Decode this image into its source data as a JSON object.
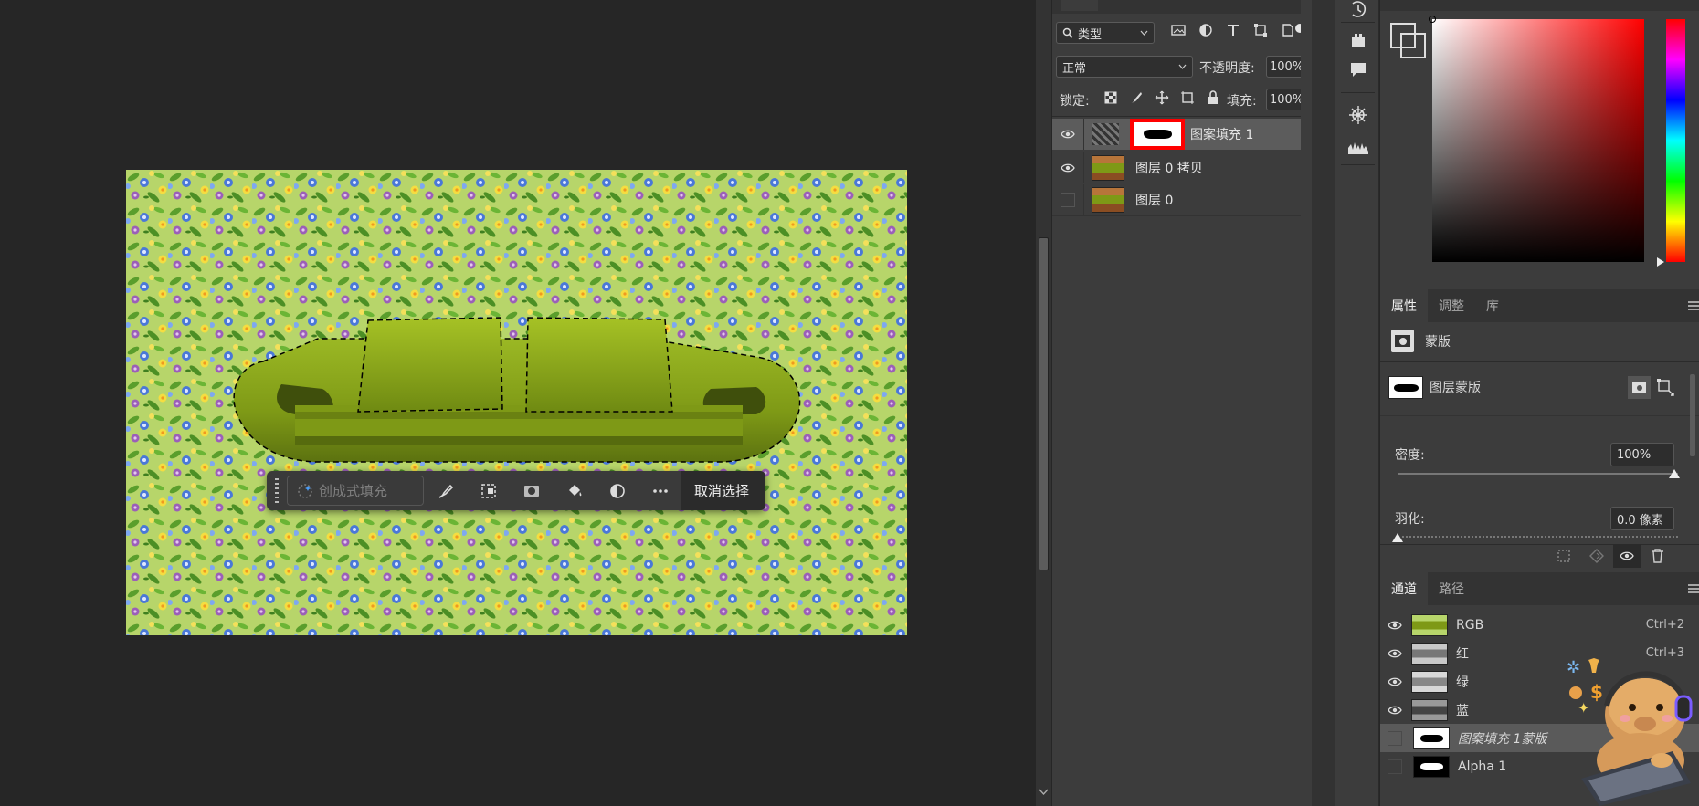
{
  "layers_panel": {
    "filter_label": "类型",
    "blend_mode": "正常",
    "opacity_label": "不透明度:",
    "opacity_value": "100%",
    "lock_label": "锁定:",
    "fill_label": "填充:",
    "fill_value": "100%",
    "layers": [
      {
        "name": "图案填充 1",
        "visible": true,
        "selected": true,
        "highlight_color": "#ff0000"
      },
      {
        "name": "图层 0 拷贝",
        "visible": true,
        "selected": false
      },
      {
        "name": "图层 0",
        "visible": false,
        "selected": false
      }
    ]
  },
  "contextual_taskbar": {
    "generative_fill_label": "创成式填充",
    "deselect_label": "取消选择",
    "icons": [
      "brush-icon",
      "select-subject-icon",
      "mask-icon",
      "paint-bucket-icon",
      "adjustment-icon",
      "more-icon"
    ]
  },
  "color_picker": {
    "foreground": "#ffffff",
    "background": "#000000",
    "hue_color": "#ff0000"
  },
  "properties_panel": {
    "tabs": [
      "属性",
      "调整",
      "库"
    ],
    "active_tab": "属性",
    "section_label": "蒙版",
    "mask_label": "图层蒙版",
    "density_label": "密度:",
    "density_value": "100%",
    "feather_label": "羽化:",
    "feather_value": "0.0 像素"
  },
  "channels_panel": {
    "tabs": [
      "通道",
      "路径"
    ],
    "active_tab": "通道",
    "channels": [
      {
        "name": "RGB",
        "shortcut": "Ctrl+2",
        "visible": true,
        "italic": false
      },
      {
        "name": "红",
        "shortcut": "Ctrl+3",
        "visible": true,
        "italic": false
      },
      {
        "name": "绿",
        "shortcut": "",
        "visible": true,
        "italic": false
      },
      {
        "name": "蓝",
        "shortcut": "",
        "visible": true,
        "italic": false
      },
      {
        "name": "图案填充 1蒙版",
        "shortcut": "",
        "visible": false,
        "italic": true
      },
      {
        "name": "Alpha 1",
        "shortcut": "",
        "visible": false,
        "italic": false
      }
    ]
  },
  "colors": {
    "sofa_green": "#8aa61a",
    "pattern_bg": "#b9d56a",
    "panel_bg": "#3c3c3c",
    "canvas_bg": "#262626"
  }
}
